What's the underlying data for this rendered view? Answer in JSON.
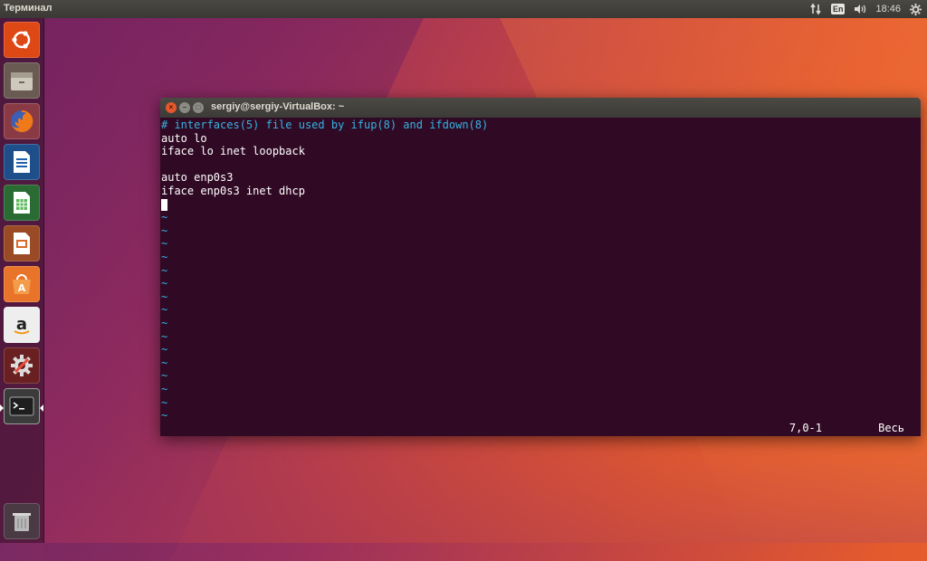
{
  "top_panel": {
    "title": "Терминал",
    "lang": "En",
    "clock": "18:46"
  },
  "launcher": {
    "items": [
      {
        "icon": "ubuntu-dash-icon",
        "color": "#dd4814"
      },
      {
        "icon": "files-icon",
        "color": "#b8b2a6"
      },
      {
        "icon": "firefox-icon",
        "color": "#e66000"
      },
      {
        "icon": "libreoffice-writer-icon",
        "color": "#1f5faa"
      },
      {
        "icon": "libreoffice-calc-icon",
        "color": "#2f8f3a"
      },
      {
        "icon": "libreoffice-impress-icon",
        "color": "#c7581f"
      },
      {
        "icon": "software-center-icon",
        "color": "#e8742a"
      },
      {
        "icon": "amazon-icon",
        "color": "#f2f2f2"
      },
      {
        "icon": "system-settings-icon",
        "color": "#c0392b"
      },
      {
        "icon": "terminal-icon",
        "color": "#2c2c2c"
      },
      {
        "icon": "trash-icon",
        "color": "#9a9a9a"
      }
    ]
  },
  "terminal": {
    "title": "sergiy@sergiy-VirtualBox: ~",
    "lines": {
      "l1": "# interfaces(5) file used by ifup(8) and ifdown(8)",
      "l2": "auto lo",
      "l3": "iface lo inet loopback",
      "l4": "",
      "l5": "auto enp0s3",
      "l6": "iface enp0s3 inet dhcp"
    },
    "tilde": "~",
    "status_position": "7,0-1",
    "status_view": "Весь",
    "colors": {
      "background": "#300a24",
      "comment": "#34b3e2",
      "text": "#ffffff"
    }
  }
}
